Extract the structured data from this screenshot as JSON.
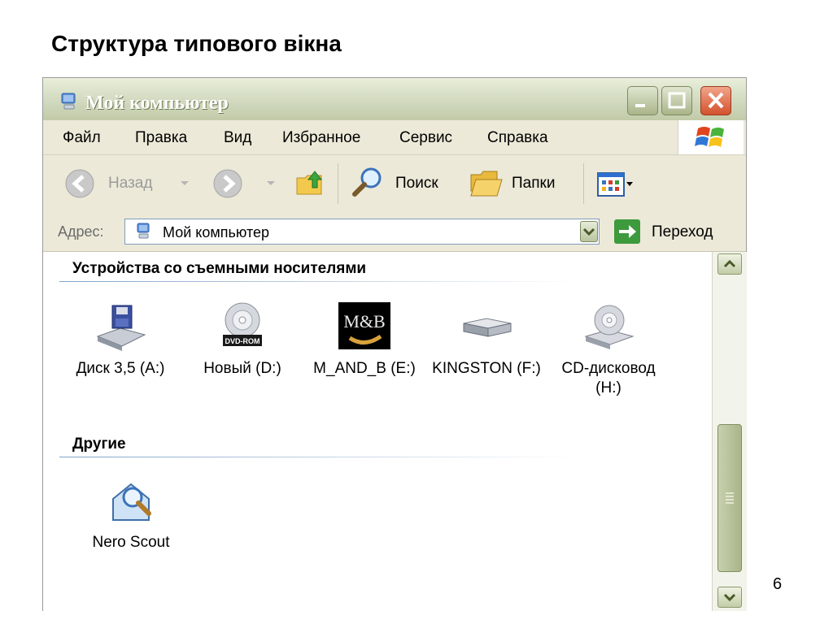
{
  "slide": {
    "title": "Структура типового вікна",
    "page_number": "6"
  },
  "window": {
    "title": "Мой компьютер",
    "menu": [
      "Файл",
      "Правка",
      "Вид",
      "Избранное",
      "Сервис",
      "Справка"
    ],
    "toolbar": {
      "back": "Назад",
      "search": "Поиск",
      "folders": "Папки"
    },
    "address": {
      "label": "Адрес:",
      "value": "Мой компьютер",
      "go": "Переход"
    },
    "groups": [
      {
        "header": "Устройства со съемными носителями",
        "items": [
          {
            "label": "Диск 3,5 (A:)",
            "icon": "floppy-drive-icon"
          },
          {
            "label": "Новый (D:)",
            "icon": "dvd-rom-icon",
            "badge": "DVD-ROM"
          },
          {
            "label": "M_AND_B (E:)",
            "icon": "custom-drive-icon",
            "badge": "M&B"
          },
          {
            "label": "KINGSTON (F:)",
            "icon": "removable-disk-icon"
          },
          {
            "label": "CD-дисковод (H:)",
            "icon": "cd-drive-icon"
          }
        ]
      },
      {
        "header": "Другие",
        "items": [
          {
            "label": "Nero Scout",
            "icon": "nero-scout-icon"
          }
        ]
      }
    ]
  },
  "colors": {
    "titlebar": "#cfd7bc",
    "close": "#d3512c",
    "group_line": "#7fa3c8",
    "go": "#3d9a3d"
  }
}
